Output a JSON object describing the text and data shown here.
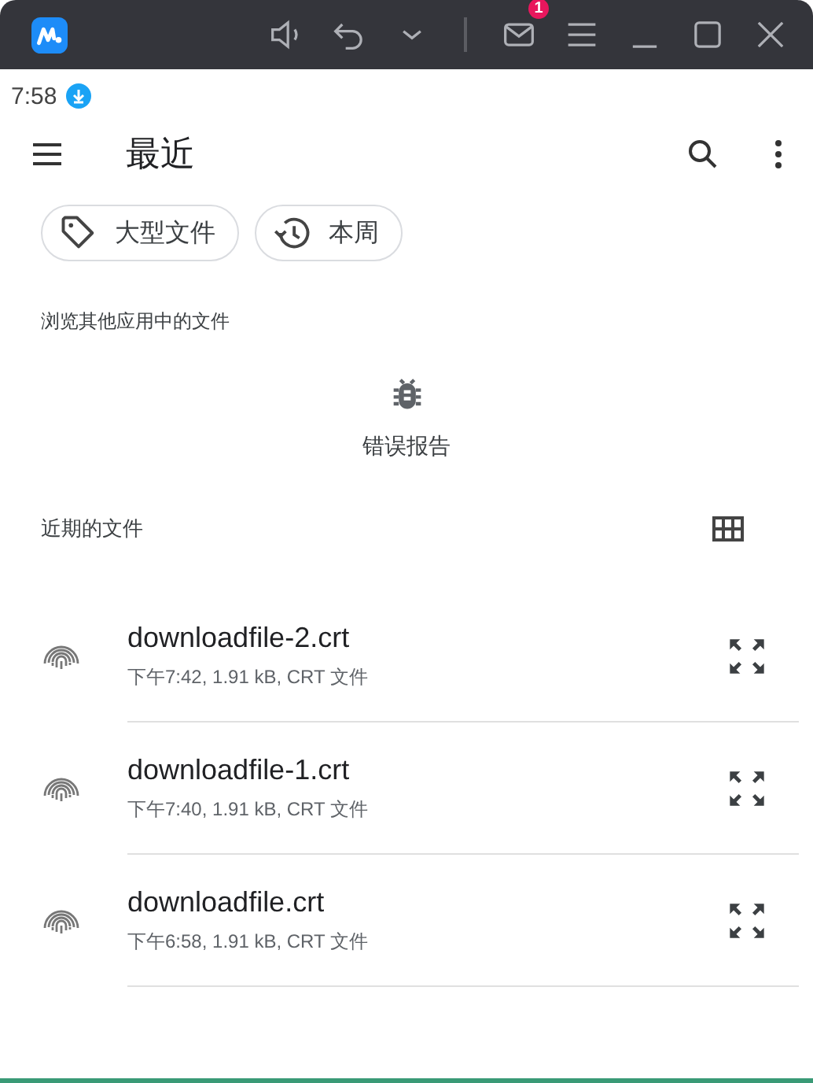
{
  "title_bar": {
    "mail_badge": "1"
  },
  "status_bar": {
    "time": "7:58"
  },
  "app_bar": {
    "title": "最近"
  },
  "chips": [
    {
      "kind": "tag",
      "label": "大型文件"
    },
    {
      "kind": "history",
      "label": "本周"
    }
  ],
  "other_apps": {
    "heading": "浏览其他应用中的文件",
    "apps": [
      {
        "label": "错误报告"
      }
    ]
  },
  "recent": {
    "heading": "近期的文件",
    "files": [
      {
        "name": "downloadfile-2.crt",
        "meta": "下午7:42, 1.91 kB, CRT 文件"
      },
      {
        "name": "downloadfile-1.crt",
        "meta": "下午7:40, 1.91 kB, CRT 文件"
      },
      {
        "name": "downloadfile.crt",
        "meta": "下午6:58, 1.91 kB, CRT 文件"
      }
    ]
  }
}
